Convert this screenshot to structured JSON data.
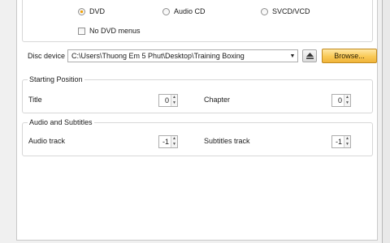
{
  "disc": {
    "options": [
      "DVD",
      "Audio CD",
      "SVCD/VCD"
    ],
    "selected": "DVD",
    "no_menus_label": "No DVD menus",
    "device_label": "Disc device",
    "device_value": "C:\\Users\\Thuong Em 5 Phut\\Desktop\\Training Boxing",
    "browse_label": "Browse...",
    "eject_icon": "eject-icon",
    "dropdown_icon": "chevron-down-icon"
  },
  "starting_position": {
    "section_label": "Starting Position",
    "title_label": "Title",
    "title_value": "0",
    "chapter_label": "Chapter",
    "chapter_value": "0"
  },
  "audio_subtitles": {
    "section_label": "Audio and Subtitles",
    "audio_label": "Audio track",
    "audio_value": "-1",
    "subtitles_label": "Subtitles track",
    "subtitles_value": "-1"
  },
  "colors": {
    "browse_button": "#f9c955",
    "radio_selected": "#f0a100"
  }
}
